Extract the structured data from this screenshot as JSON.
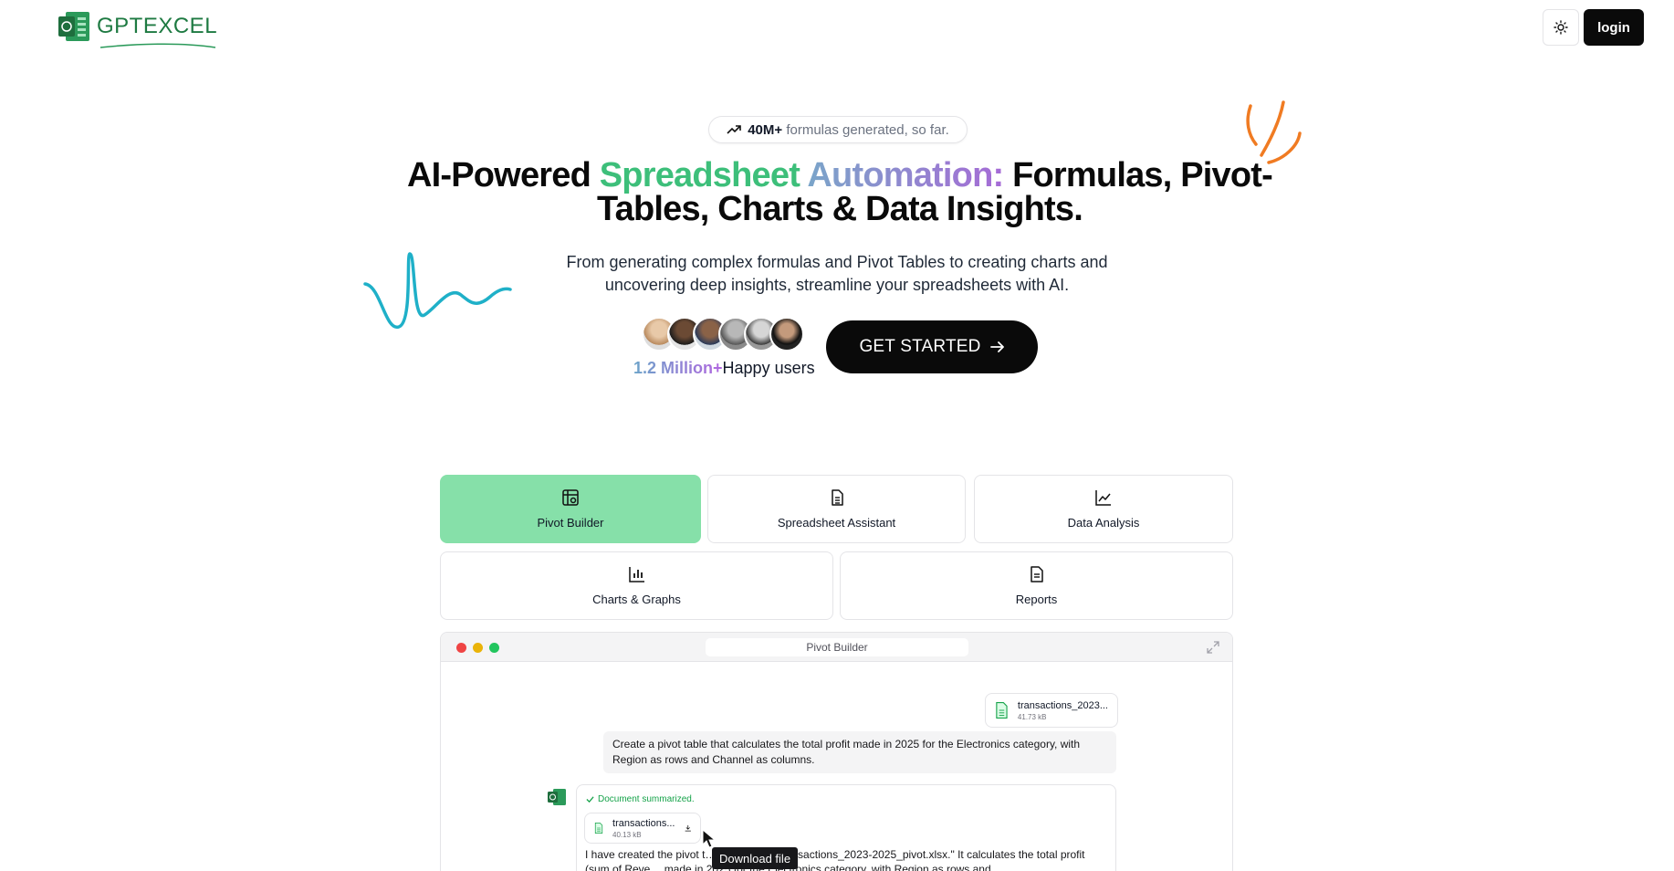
{
  "header": {
    "brand": "GPTEXCEL",
    "theme_toggle_icon": "sun-icon",
    "login_label": "login"
  },
  "hero": {
    "stat_icon": "trending-up-icon",
    "stat_value": "40M+",
    "stat_text": "formulas generated, so far.",
    "title_part1": "AI-Powered ",
    "title_part2": "Spreadsheet ",
    "title_part3": "Automation:",
    "title_line1_rest": " Formulas, Pivot-",
    "title_line2": "Tables, Charts & Data Insights.",
    "subtitle": "From generating complex formulas and Pivot Tables to creating charts and uncovering deep insights, streamline your spreadsheets with AI.",
    "users_highlight": "1.2 Million+",
    "users_text": "Happy users",
    "cta_label": "GET STARTED",
    "cta_icon": "arrow-right-icon"
  },
  "tabs": [
    {
      "label": "Pivot Builder",
      "icon": "pivot-table-icon",
      "active": true
    },
    {
      "label": "Spreadsheet Assistant",
      "icon": "spreadsheet-file-icon",
      "active": false
    },
    {
      "label": "Data Analysis",
      "icon": "line-chart-icon",
      "active": false
    },
    {
      "label": "Charts & Graphs",
      "icon": "bar-chart-icon",
      "active": false
    },
    {
      "label": "Reports",
      "icon": "report-file-icon",
      "active": false
    }
  ],
  "window": {
    "title": "Pivot Builder",
    "upload_file": {
      "name": "transactions_2023...",
      "size": "41.73 kB"
    },
    "user_message": "Create a pivot table that calculates the total profit made in 2025 for the Electronics category, with Region as rows and Channel as columns.",
    "summary_status": "Document summarized.",
    "result_file": {
      "name": "transactions...",
      "size": "40.13 kB"
    },
    "bot_message_visible": "I have created the pivot t… d in the file \"transactions_2023-2025_pivot.xlsx.\" It calculates the total profit (sum of Reve… made in 2025 for the Electronics category, with Region as rows and",
    "tooltip": "Download file"
  },
  "colors": {
    "accent_green": "#86e0a9",
    "title_green": "#3dbf7a",
    "title_purple": "#a66bd6",
    "brand_green": "#1e7a42",
    "deco_orange": "#f07b22",
    "deco_teal": "#1fb0c8"
  }
}
